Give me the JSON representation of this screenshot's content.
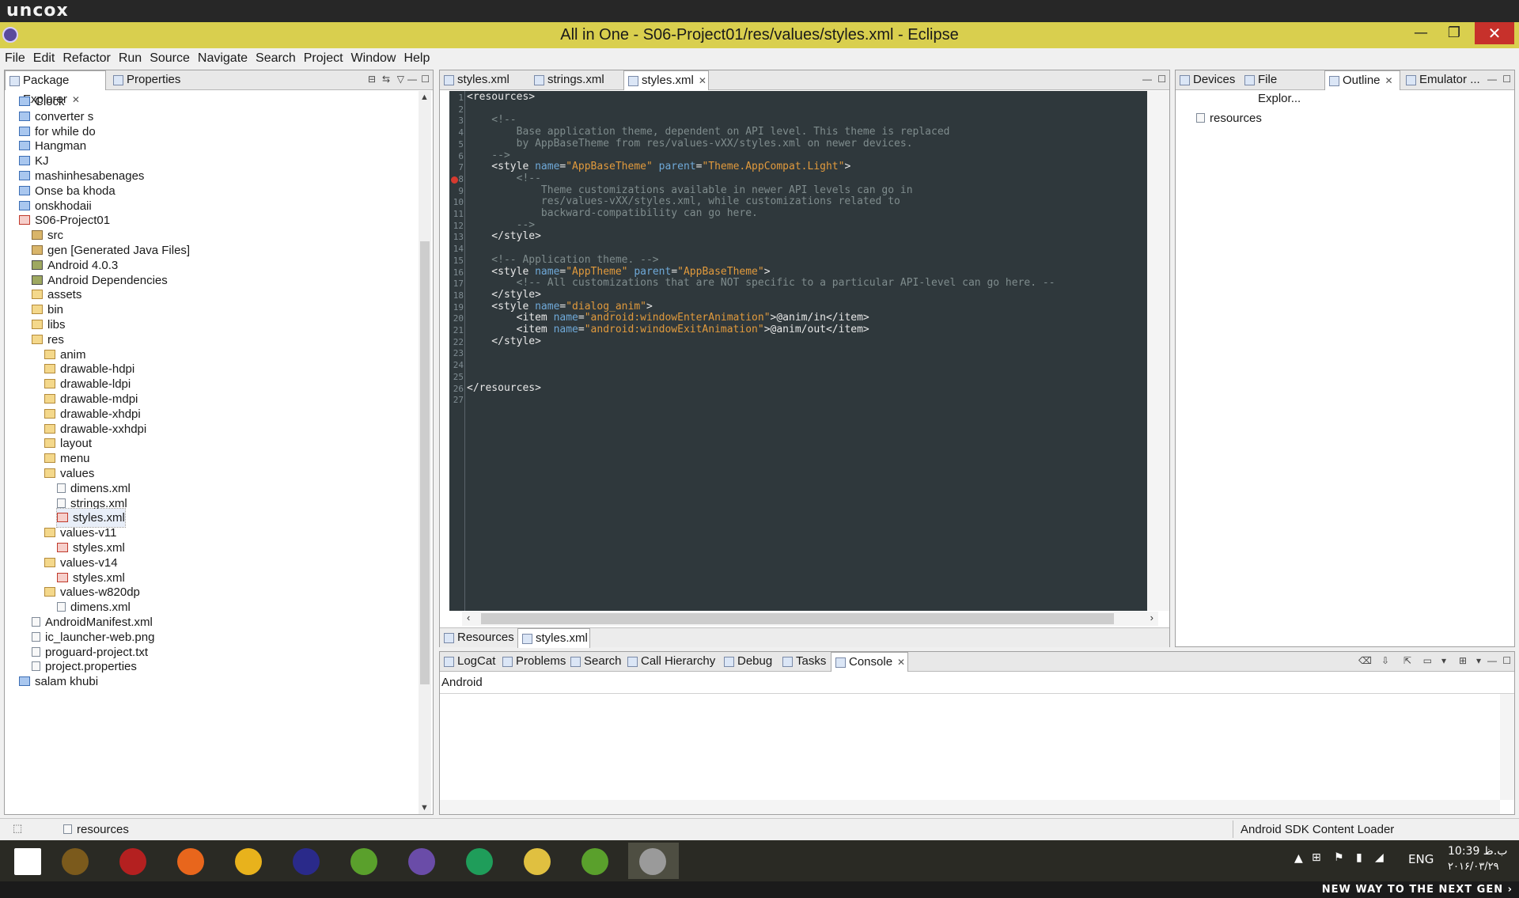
{
  "brand": {
    "logo_text": "uncox"
  },
  "window": {
    "title": "All in One - S06-Project01/res/values/styles.xml - Eclipse",
    "minimize": "—",
    "maximize": "❐",
    "close": "✕"
  },
  "menu": [
    "File",
    "Edit",
    "Refactor",
    "Run",
    "Source",
    "Navigate",
    "Search",
    "Project",
    "Window",
    "Help"
  ],
  "package_explorer": {
    "tabs": [
      "Package Explorer",
      "Properties"
    ],
    "tree": [
      {
        "label": "Clock",
        "icon": "project-folder",
        "indent": 0
      },
      {
        "label": "converter s",
        "icon": "project-folder",
        "indent": 0
      },
      {
        "label": "for while do",
        "icon": "project-folder",
        "indent": 0
      },
      {
        "label": "Hangman",
        "icon": "android-project",
        "indent": 0
      },
      {
        "label": "KJ",
        "icon": "project-folder",
        "indent": 0
      },
      {
        "label": "mashinhesabenages",
        "icon": "project-folder",
        "indent": 0
      },
      {
        "label": "Onse ba khoda",
        "icon": "project-folder",
        "indent": 0
      },
      {
        "label": "onskhodaii",
        "icon": "project-folder",
        "indent": 0
      },
      {
        "label": "S06-Project01",
        "icon": "android-project-error",
        "indent": 0
      },
      {
        "label": "src",
        "icon": "source-folder",
        "indent": 1
      },
      {
        "label": "gen [Generated Java Files]",
        "icon": "source-folder",
        "indent": 1
      },
      {
        "label": "Android 4.0.3",
        "icon": "library",
        "indent": 1
      },
      {
        "label": "Android Dependencies",
        "icon": "library",
        "indent": 1
      },
      {
        "label": "assets",
        "icon": "folder",
        "indent": 1
      },
      {
        "label": "bin",
        "icon": "folder",
        "indent": 1
      },
      {
        "label": "libs",
        "icon": "folder",
        "indent": 1
      },
      {
        "label": "res",
        "icon": "folder-error",
        "indent": 1
      },
      {
        "label": "anim",
        "icon": "folder",
        "indent": 2
      },
      {
        "label": "drawable-hdpi",
        "icon": "folder",
        "indent": 2
      },
      {
        "label": "drawable-ldpi",
        "icon": "folder",
        "indent": 2
      },
      {
        "label": "drawable-mdpi",
        "icon": "folder",
        "indent": 2
      },
      {
        "label": "drawable-xhdpi",
        "icon": "folder",
        "indent": 2
      },
      {
        "label": "drawable-xxhdpi",
        "icon": "folder",
        "indent": 2
      },
      {
        "label": "layout",
        "icon": "folder",
        "indent": 2
      },
      {
        "label": "menu",
        "icon": "folder",
        "indent": 2
      },
      {
        "label": "values",
        "icon": "folder-error",
        "indent": 2
      },
      {
        "label": "dimens.xml",
        "icon": "xml-file",
        "indent": 3
      },
      {
        "label": "strings.xml",
        "icon": "xml-file",
        "indent": 3
      },
      {
        "label": "styles.xml",
        "icon": "xml-file-error",
        "indent": 3
      },
      {
        "label": "values-v11",
        "icon": "folder-error",
        "indent": 2
      },
      {
        "label": "styles.xml",
        "icon": "xml-file-error",
        "indent": 3
      },
      {
        "label": "values-v14",
        "icon": "folder-error",
        "indent": 2
      },
      {
        "label": "styles.xml",
        "icon": "xml-file-error",
        "indent": 3
      },
      {
        "label": "values-w820dp",
        "icon": "folder",
        "indent": 2
      },
      {
        "label": "dimens.xml",
        "icon": "xml-file",
        "indent": 3
      },
      {
        "label": "AndroidManifest.xml",
        "icon": "xml-file",
        "indent": 1
      },
      {
        "label": "ic_launcher-web.png",
        "icon": "file",
        "indent": 1
      },
      {
        "label": "proguard-project.txt",
        "icon": "file",
        "indent": 1
      },
      {
        "label": "project.properties",
        "icon": "file",
        "indent": 1
      },
      {
        "label": "salam khubi",
        "icon": "project-folder",
        "indent": 0
      }
    ]
  },
  "editor": {
    "tabs": [
      "styles.xml",
      "strings.xml",
      "styles.xml"
    ],
    "active_tab_index": 2,
    "bottom_tabs": [
      "Resources",
      "styles.xml"
    ],
    "line_numbers": [
      "1",
      "2",
      "3",
      "4",
      "5",
      "6",
      "7",
      "8",
      "9",
      "10",
      "11",
      "12",
      "13",
      "14",
      "15",
      "16",
      "17",
      "18",
      "19",
      "20",
      "21",
      "22",
      "23",
      "24",
      "25",
      "26",
      "27"
    ],
    "code": [
      [
        {
          "t": "<resources>",
          "c": "tag"
        }
      ],
      [],
      [
        {
          "t": "    <!--",
          "c": "cm"
        }
      ],
      [
        {
          "t": "        Base application theme, dependent on API level. This theme is replaced",
          "c": "cm"
        }
      ],
      [
        {
          "t": "        by AppBaseTheme from res/values-vXX/styles.xml on newer devices.",
          "c": "cm"
        }
      ],
      [
        {
          "t": "    -->",
          "c": "cm"
        }
      ],
      [
        {
          "t": "    <style ",
          "c": "tag"
        },
        {
          "t": "name",
          "c": "an"
        },
        {
          "t": "=",
          "c": "tag"
        },
        {
          "t": "\"AppBaseTheme\"",
          "c": "av"
        },
        {
          "t": " ",
          "c": "tag"
        },
        {
          "t": "parent",
          "c": "an"
        },
        {
          "t": "=",
          "c": "tag"
        },
        {
          "t": "\"Theme.AppCompat.Light\"",
          "c": "av"
        },
        {
          "t": ">",
          "c": "tag"
        }
      ],
      [
        {
          "t": "        <!--",
          "c": "cm"
        }
      ],
      [
        {
          "t": "            Theme customizations available in newer API levels can go in",
          "c": "cm"
        }
      ],
      [
        {
          "t": "            res/values-vXX/styles.xml, while customizations related to",
          "c": "cm"
        }
      ],
      [
        {
          "t": "            backward-compatibility can go here.",
          "c": "cm"
        }
      ],
      [
        {
          "t": "        -->",
          "c": "cm"
        }
      ],
      [
        {
          "t": "    </style>",
          "c": "tag"
        }
      ],
      [],
      [
        {
          "t": "    <!-- Application theme. -->",
          "c": "cm"
        }
      ],
      [
        {
          "t": "    <style ",
          "c": "tag"
        },
        {
          "t": "name",
          "c": "an"
        },
        {
          "t": "=",
          "c": "tag"
        },
        {
          "t": "\"AppTheme\"",
          "c": "av"
        },
        {
          "t": " ",
          "c": "tag"
        },
        {
          "t": "parent",
          "c": "an"
        },
        {
          "t": "=",
          "c": "tag"
        },
        {
          "t": "\"AppBaseTheme\"",
          "c": "av"
        },
        {
          "t": ">",
          "c": "tag"
        }
      ],
      [
        {
          "t": "        <!-- All customizations that are NOT specific to a particular API-level can go here. --",
          "c": "cm"
        }
      ],
      [
        {
          "t": "    </style>",
          "c": "tag"
        }
      ],
      [
        {
          "t": "    <style ",
          "c": "tag"
        },
        {
          "t": "name",
          "c": "an"
        },
        {
          "t": "=",
          "c": "tag"
        },
        {
          "t": "\"dialog_anim\"",
          "c": "av"
        },
        {
          "t": ">",
          "c": "tag"
        }
      ],
      [
        {
          "t": "        <item ",
          "c": "tag"
        },
        {
          "t": "name",
          "c": "an"
        },
        {
          "t": "=",
          "c": "tag"
        },
        {
          "t": "\"android:windowEnterAnimation\"",
          "c": "av"
        },
        {
          "t": ">@anim/in</item>",
          "c": "tag"
        }
      ],
      [
        {
          "t": "        <item ",
          "c": "tag"
        },
        {
          "t": "name",
          "c": "an"
        },
        {
          "t": "=",
          "c": "tag"
        },
        {
          "t": "\"android:windowExitAnimation\"",
          "c": "av"
        },
        {
          "t": ">@anim/out</item>",
          "c": "tag"
        }
      ],
      [
        {
          "t": "    </style>",
          "c": "tag"
        }
      ],
      [],
      [],
      [],
      [
        {
          "t": "</resources>",
          "c": "tag"
        }
      ],
      []
    ]
  },
  "right_panel": {
    "tabs": [
      "Devices",
      "File Explor...",
      "Outline",
      "Emulator ..."
    ],
    "outline_item": "resources"
  },
  "console_panel": {
    "tabs": [
      "LogCat",
      "Problems",
      "Search",
      "Call Hierarchy",
      "Debug",
      "Tasks",
      "Console"
    ],
    "label": "Android"
  },
  "status": {
    "left": "resources",
    "right": "Android SDK Content Loader"
  },
  "taskbar": {
    "apps": [
      "start-icon",
      "warcraft-icon",
      "red-figure-icon",
      "firefox-icon",
      "puzzle-icon",
      "eclipse-icon",
      "android-studio-icon",
      "visual-studio-icon",
      "globe-icon",
      "file-explorer-icon",
      "android-icon",
      "settings-gear-icon"
    ],
    "active_index": 11,
    "language": "ENG",
    "time": "10:39 ب.ظ",
    "date": "۲۰۱۶/۰۳/۲۹"
  },
  "footer_text": "NEW WAY TO THE NEXT GEN ›",
  "colors": {
    "title_bar": "#d9cf4e",
    "editor_bg": "#2f383c",
    "xml_attr_name": "#6fa9d8",
    "xml_attr_value": "#e19a3c",
    "xml_comment": "#7f8c8d"
  }
}
